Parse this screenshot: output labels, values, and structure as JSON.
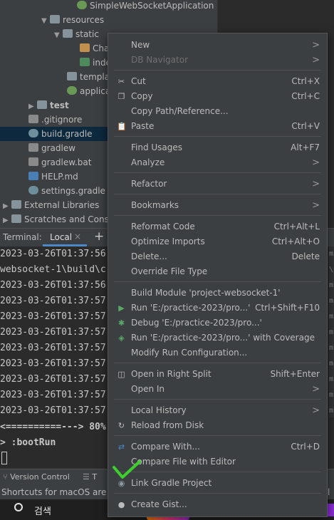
{
  "tree": {
    "items": [
      {
        "label": "SimpleWebSocketApplication",
        "icon": "spring-class-icon"
      },
      {
        "label": "resources",
        "icon": "folder-icon"
      },
      {
        "label": "static",
        "icon": "folder-icon"
      },
      {
        "label": "Chat",
        "icon": "js-file-icon"
      },
      {
        "label": "inde",
        "icon": "html-file-icon"
      },
      {
        "label": "templat",
        "icon": "folder-icon"
      },
      {
        "label": "applicat",
        "icon": "spring-config-icon"
      },
      {
        "label": "test",
        "icon": "folder-icon"
      },
      {
        "label": ".gitignore",
        "icon": "gitignore-icon"
      },
      {
        "label": "build.gradle",
        "icon": "gradle-icon"
      },
      {
        "label": "gradlew",
        "icon": "file-icon"
      },
      {
        "label": "gradlew.bat",
        "icon": "file-icon"
      },
      {
        "label": "HELP.md",
        "icon": "markdown-icon"
      },
      {
        "label": "settings.gradle",
        "icon": "gradle-icon"
      },
      {
        "label": "External Libraries",
        "icon": "library-icon"
      },
      {
        "label": "Scratches and Conso",
        "icon": "scratches-icon"
      }
    ]
  },
  "terminal": {
    "label": "Terminal:",
    "tab": "Local",
    "close": "×",
    "add": "+",
    "lines": [
      "2023-03-26T01:37:56",
      "websocket-1\\build\\c",
      "2023-03-26T01:37:56",
      "2023-03-26T01:37:57",
      "2023-03-26T01:37:57",
      "2023-03-26T01:37:57",
      "2023-03-26T01:37:57",
      "2023-03-26T01:37:57",
      "2023-03-26T01:37:57",
      "2023-03-26T01:37:57",
      "2023-03-26T01:37:57",
      "<==========---> 80%",
      "> :bootRun"
    ],
    "gutter": [
      "m",
      "\\p",
      "m",
      "m",
      "m",
      "m",
      "m",
      "m",
      "m",
      "m",
      "m"
    ]
  },
  "bottom": {
    "version_control": "Version Control",
    "todo": "T",
    "status": "Shortcuts for macOS are no",
    "status_right": "l t"
  },
  "taskbar": {
    "search": "검색"
  },
  "menu": {
    "items": [
      {
        "label": "New",
        "shortcut": "",
        "submenu": true,
        "icon": ""
      },
      {
        "label": "DB Navigator",
        "shortcut": "",
        "submenu": true,
        "icon": "",
        "disabled": true
      },
      {
        "label": "Cut",
        "shortcut": "Ctrl+X",
        "icon": "cut-icon"
      },
      {
        "label": "Copy",
        "shortcut": "Ctrl+C",
        "icon": "copy-icon"
      },
      {
        "label": "Copy Path/Reference...",
        "shortcut": "",
        "icon": ""
      },
      {
        "label": "Paste",
        "shortcut": "Ctrl+V",
        "icon": "paste-icon"
      },
      {
        "label": "Find Usages",
        "shortcut": "Alt+F7",
        "icon": ""
      },
      {
        "label": "Analyze",
        "shortcut": "",
        "submenu": true,
        "icon": ""
      },
      {
        "label": "Refactor",
        "shortcut": "",
        "submenu": true,
        "icon": ""
      },
      {
        "label": "Bookmarks",
        "shortcut": "",
        "submenu": true,
        "icon": ""
      },
      {
        "label": "Reformat Code",
        "shortcut": "Ctrl+Alt+L",
        "icon": ""
      },
      {
        "label": "Optimize Imports",
        "shortcut": "Ctrl+Alt+O",
        "icon": ""
      },
      {
        "label": "Delete...",
        "shortcut": "Delete",
        "icon": ""
      },
      {
        "label": "Override File Type",
        "shortcut": "",
        "icon": ""
      },
      {
        "label": "Build Module 'project-websocket-1'",
        "shortcut": "",
        "icon": ""
      },
      {
        "label": "Run 'E:/practice-2023/pro...'",
        "shortcut": "Ctrl+Shift+F10",
        "icon": "run-icon"
      },
      {
        "label": "Debug 'E:/practice-2023/pro...'",
        "shortcut": "",
        "icon": "debug-icon"
      },
      {
        "label": "Run 'E:/practice-2023/pro...' with Coverage",
        "shortcut": "",
        "icon": "coverage-icon"
      },
      {
        "label": "Modify Run Configuration...",
        "shortcut": "",
        "icon": ""
      },
      {
        "label": "Open in Right Split",
        "shortcut": "Shift+Enter",
        "icon": "split-icon"
      },
      {
        "label": "Open In",
        "shortcut": "",
        "submenu": true,
        "icon": ""
      },
      {
        "label": "Local History",
        "shortcut": "",
        "submenu": true,
        "icon": ""
      },
      {
        "label": "Reload from Disk",
        "shortcut": "",
        "icon": "reload-icon"
      },
      {
        "label": "Compare With...",
        "shortcut": "Ctrl+D",
        "icon": "compare-icon"
      },
      {
        "label": "Compare File with Editor",
        "shortcut": "",
        "icon": ""
      },
      {
        "label": "Link Gradle Project",
        "shortcut": "",
        "icon": "gradle-icon"
      },
      {
        "label": "Create Gist...",
        "shortcut": "",
        "icon": "github-icon"
      }
    ]
  },
  "colors": {
    "menu_bg": "#3c3f41",
    "selection": "#0d293e",
    "checkmark": "#3ecf2e",
    "run_green": "#59a869"
  }
}
